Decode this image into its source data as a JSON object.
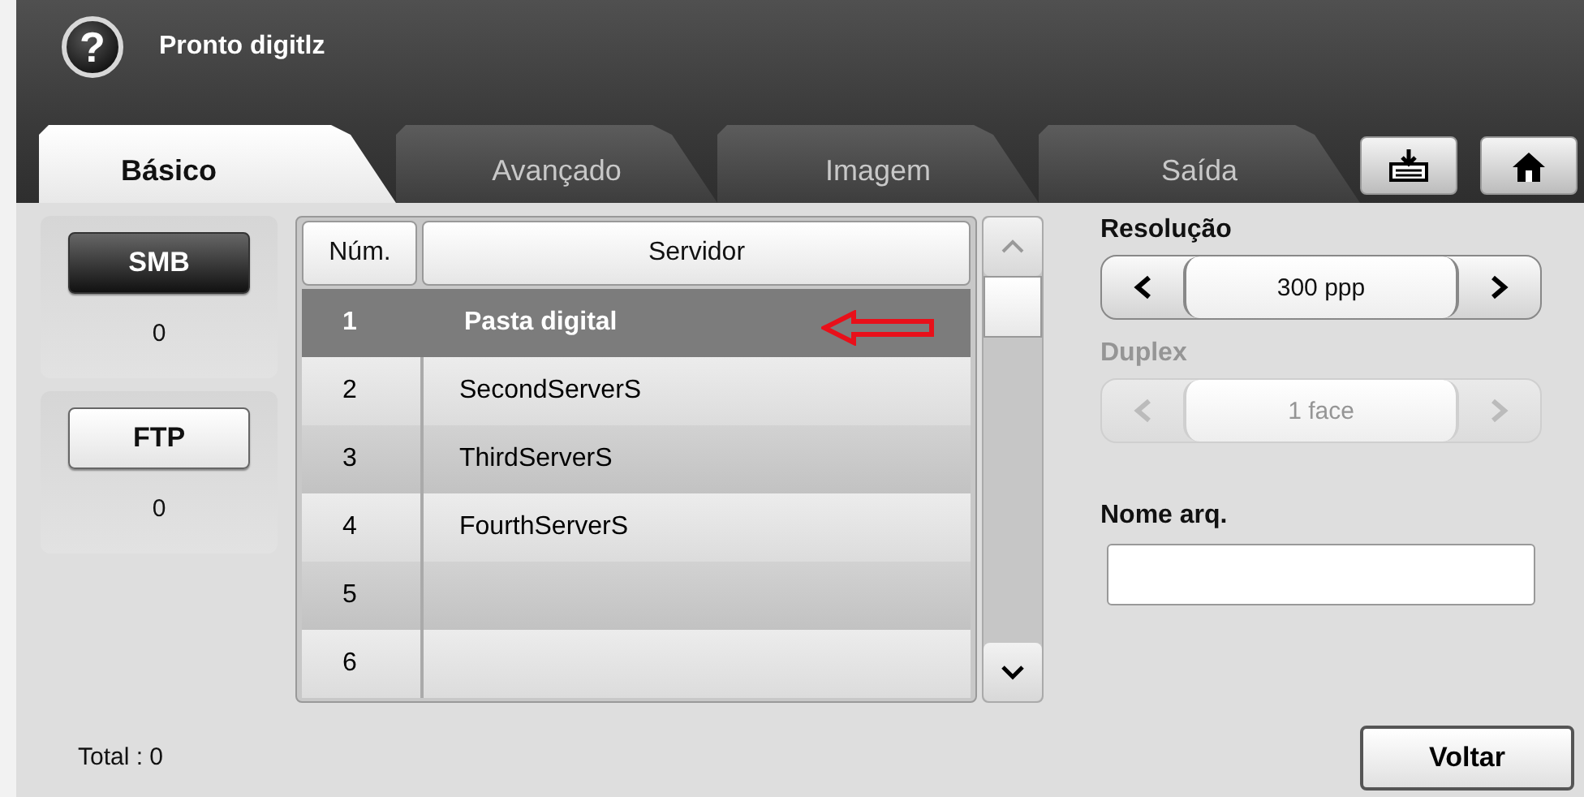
{
  "window": {
    "title": "Pronto digitlz"
  },
  "help_button": {
    "label": "?"
  },
  "tabs": [
    {
      "label": "Básico",
      "selected": true
    },
    {
      "label": "Avançado",
      "selected": false
    },
    {
      "label": "Imagem",
      "selected": false
    },
    {
      "label": "Saída",
      "selected": false
    }
  ],
  "toolbar_buttons": [
    {
      "kind": "tray"
    },
    {
      "kind": "home"
    }
  ],
  "protocols": [
    {
      "label": "SMB",
      "selected": true,
      "count": "0"
    },
    {
      "label": "FTP",
      "selected": false,
      "count": "0"
    }
  ],
  "table": {
    "columns": [
      "Núm.",
      "Servidor"
    ],
    "rows": [
      {
        "num": "1",
        "server": "Pasta digital",
        "selected": true,
        "annotated": true
      },
      {
        "num": "2",
        "server": "SecondServerS",
        "selected": false,
        "annotated": false
      },
      {
        "num": "3",
        "server": "ThirdServerS",
        "selected": false,
        "annotated": false
      },
      {
        "num": "4",
        "server": "FourthServerS",
        "selected": false,
        "annotated": false
      },
      {
        "num": "5",
        "selected": false,
        "annotated": false
      },
      {
        "num": "6",
        "selected": false,
        "annotated": false
      }
    ]
  },
  "settings": [
    {
      "label": "Resolução",
      "value": "300 ppp",
      "disabled": false
    },
    {
      "label": "Duplex",
      "value": "1 face",
      "disabled": true
    }
  ],
  "filename": {
    "label": "Nome arq."
  },
  "total": "Total : 0",
  "back_button": "Voltar"
}
